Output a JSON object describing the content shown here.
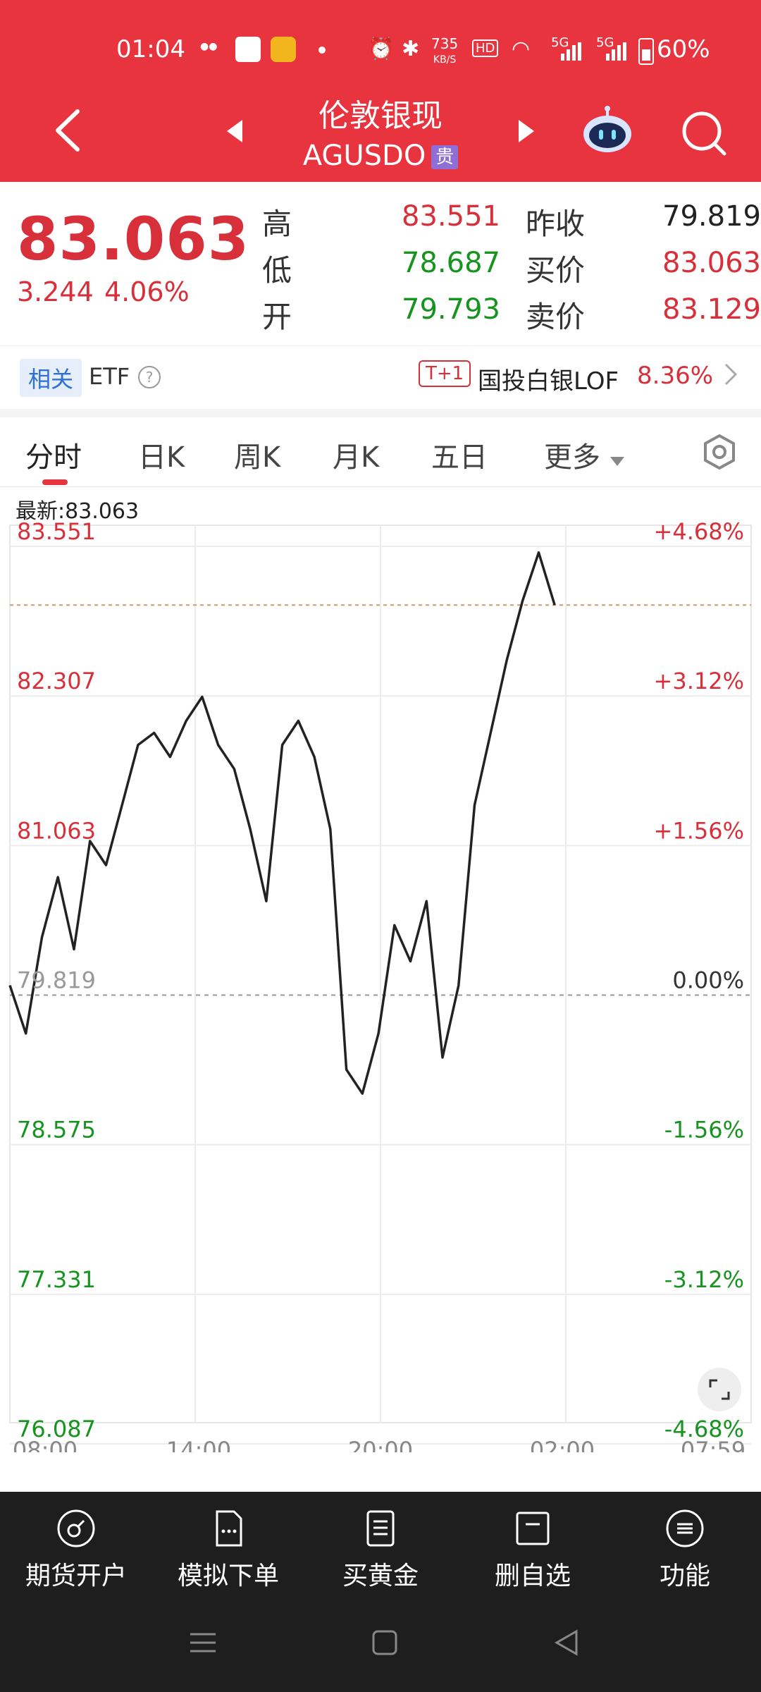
{
  "status_bar": {
    "time": "01:04",
    "net_speed_top": "735",
    "net_speed_bottom": "KB/S",
    "hd": "HD",
    "sig1": "5G",
    "sig2": "5G",
    "battery": "60%"
  },
  "header": {
    "title": "伦敦银现",
    "code": "AGUSDO",
    "tag": "贵"
  },
  "quote": {
    "price": "83.063",
    "change": "3.244",
    "change_pct": "4.06%",
    "high_label": "高",
    "high": "83.551",
    "low_label": "低",
    "low": "78.687",
    "open_label": "开",
    "open": "79.793",
    "prev_close_label": "昨收",
    "prev_close": "79.819",
    "bid_label": "买价",
    "bid": "83.063",
    "ask_label": "卖价",
    "ask": "83.129"
  },
  "etf": {
    "related_label": "相关",
    "etf_label": "ETF",
    "help_icon": "?",
    "badge": "T+1",
    "fund_name": "国投白银LOF",
    "fund_change": "8.36%"
  },
  "tabs": [
    "分时",
    "日K",
    "周K",
    "月K",
    "五日",
    "更多"
  ],
  "chart": {
    "latest_label": "最新:83.063",
    "y_left": [
      "83.551",
      "82.307",
      "81.063",
      "79.819",
      "78.575",
      "77.331",
      "76.087"
    ],
    "y_right": [
      "+4.68%",
      "+3.12%",
      "+1.56%",
      "0.00%",
      "-1.56%",
      "-3.12%",
      "-4.68%"
    ],
    "x_labels": [
      "08:00",
      "14:00",
      "20:00",
      "02:00",
      "07:59"
    ]
  },
  "chart_data": {
    "type": "line",
    "title": "",
    "xlabel": "",
    "ylabel": "",
    "prev_close": 79.819,
    "ylim": [
      76.087,
      83.551
    ],
    "x": [
      "08:00",
      "08:30",
      "09:00",
      "09:30",
      "10:00",
      "10:30",
      "11:00",
      "11:30",
      "12:00",
      "12:30",
      "13:00",
      "13:30",
      "14:00",
      "14:30",
      "15:00",
      "15:30",
      "16:00",
      "16:30",
      "17:00",
      "17:30",
      "18:00",
      "18:30",
      "19:00",
      "19:30",
      "20:00",
      "20:30",
      "21:00",
      "21:30",
      "22:00",
      "22:30",
      "23:00",
      "23:30",
      "00:00",
      "00:30",
      "01:00"
    ],
    "values": [
      79.9,
      79.5,
      80.3,
      80.8,
      80.2,
      81.1,
      80.9,
      81.4,
      81.9,
      82.0,
      81.8,
      82.1,
      82.3,
      81.9,
      81.7,
      81.2,
      80.6,
      81.9,
      82.1,
      81.8,
      81.2,
      79.2,
      79.0,
      79.5,
      80.4,
      80.1,
      80.6,
      79.3,
      79.9,
      81.4,
      82.0,
      82.6,
      83.1,
      83.5,
      83.063
    ]
  },
  "bottom_bar": {
    "items": [
      "期货开户",
      "模拟下单",
      "买黄金",
      "删自选",
      "功能"
    ]
  },
  "colors": {
    "header_red": "#e8343f",
    "up": "#d8303a",
    "down": "#17931f",
    "bottom_bg": "#1e1e1e"
  }
}
